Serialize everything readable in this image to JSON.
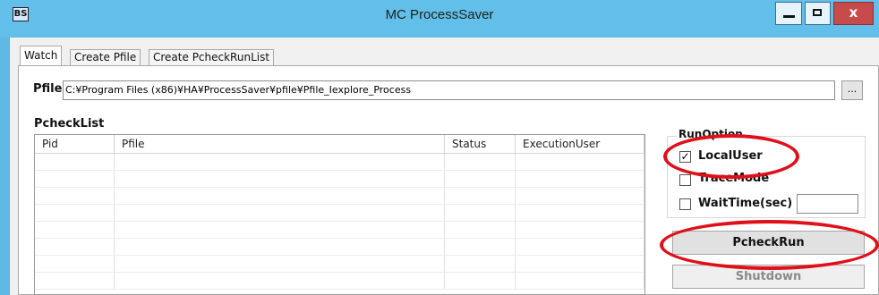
{
  "window": {
    "icon_text": "BS",
    "title": "MC ProcessSaver",
    "minimize_glyph": "_",
    "close_glyph": "x"
  },
  "tabs": [
    {
      "label": "Watch",
      "active": true
    },
    {
      "label": "Create Pfile",
      "active": false
    },
    {
      "label": "Create PcheckRunList",
      "active": false
    }
  ],
  "pfile": {
    "label": "Pfile:",
    "value": "C:¥Program Files (x86)¥HA¥ProcessSaver¥pfile¥Pfile_Iexplore_Process",
    "browse_label": "..."
  },
  "pchecklist": {
    "label": "PcheckList",
    "columns": [
      "Pid",
      "Pfile",
      "Status",
      "ExecutionUser"
    ],
    "rows": []
  },
  "run_option": {
    "title": "RunOption",
    "local_user": {
      "label": "LocalUser",
      "checked": true
    },
    "trace_mode": {
      "label": "TraceMode",
      "checked": false
    },
    "wait_time": {
      "label": "WaitTime(sec)",
      "checked": false,
      "value": ""
    }
  },
  "buttons": {
    "pcheck_run": "PcheckRun",
    "shutdown": "Shutdown"
  },
  "annotation_color": "#e0101a"
}
